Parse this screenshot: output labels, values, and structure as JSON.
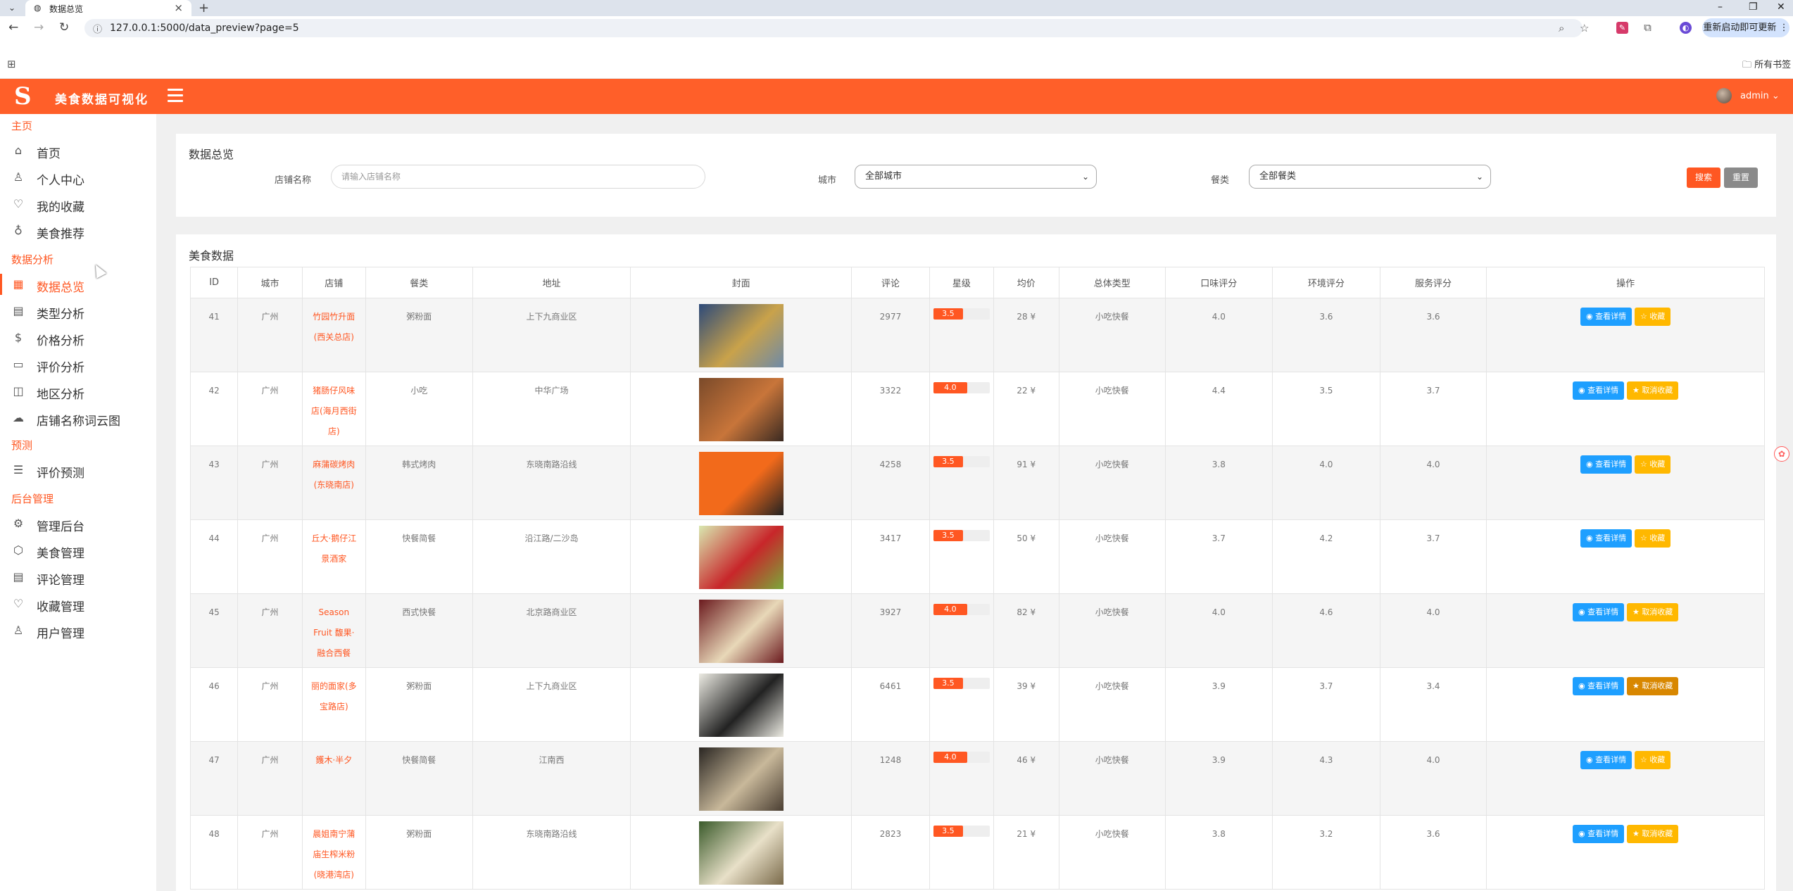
{
  "browser": {
    "tab_title": "数据总览",
    "url": "127.0.0.1:5000/data_preview?page=5",
    "restart_label": "重新启动即可更新",
    "bookmarks_label": "所有书签"
  },
  "header": {
    "app_title": "美食数据可视化",
    "user": "admin"
  },
  "sidebar": {
    "sections": [
      {
        "title": "主页",
        "items": [
          {
            "label": "首页",
            "icon": "home-icon"
          },
          {
            "label": "个人中心",
            "icon": "user-icon"
          },
          {
            "label": "我的收藏",
            "icon": "heart-icon"
          },
          {
            "label": "美食推荐",
            "icon": "lightbulb-icon"
          }
        ]
      },
      {
        "title": "数据分析",
        "items": [
          {
            "label": "数据总览",
            "icon": "table-icon"
          },
          {
            "label": "类型分析",
            "icon": "bar-chart-icon"
          },
          {
            "label": "价格分析",
            "icon": "dollar-icon"
          },
          {
            "label": "评价分析",
            "icon": "comment-icon"
          },
          {
            "label": "地区分析",
            "icon": "map-icon"
          },
          {
            "label": "店铺名称词云图",
            "icon": "cloud-icon"
          }
        ]
      },
      {
        "title": "预测",
        "items": [
          {
            "label": "评价预测",
            "icon": "list-icon"
          }
        ]
      },
      {
        "title": "后台管理",
        "items": [
          {
            "label": "管理后台",
            "icon": "gear-icon"
          },
          {
            "label": "美食管理",
            "icon": "cube-icon"
          },
          {
            "label": "评论管理",
            "icon": "message-icon"
          },
          {
            "label": "收藏管理",
            "icon": "heart-outline-icon"
          },
          {
            "label": "用户管理",
            "icon": "user-icon"
          }
        ]
      }
    ]
  },
  "filter": {
    "title": "数据总览",
    "shop_label": "店铺名称",
    "shop_placeholder": "请输入店铺名称",
    "city_label": "城市",
    "city_value": "全部城市",
    "cuisine_label": "餐类",
    "cuisine_value": "全部餐类",
    "search_btn": "搜索",
    "reset_btn": "重置"
  },
  "table": {
    "title": "美食数据",
    "columns": [
      "ID",
      "城市",
      "店铺",
      "餐类",
      "地址",
      "封面",
      "评论",
      "星级",
      "均价",
      "总体类型",
      "口味评分",
      "环境评分",
      "服务评分",
      "操作"
    ],
    "view_label": "查看详情",
    "fav_label": "收藏",
    "unfav_label": "取消收藏",
    "rows": [
      {
        "id": "41",
        "city": "广州",
        "shop": "竹园竹升面(西关总店)",
        "cuisine": "粥粉面",
        "addr": "上下九商业区",
        "reviews": "2977",
        "star": "3.5",
        "star_frac": 0.7,
        "price": "28 ¥",
        "type": "小吃快餐",
        "taste": "4.0",
        "env": "3.6",
        "service": "3.6",
        "fav": false,
        "cover": [
          "#2d4a7a",
          "#c9a24a",
          "#6e8aa8"
        ]
      },
      {
        "id": "42",
        "city": "广州",
        "shop": "猪肠仔风味店(海月西街店)",
        "cuisine": "小吃",
        "addr": "中华广场",
        "reviews": "3322",
        "star": "4.0",
        "star_frac": 0.8,
        "price": "22 ¥",
        "type": "小吃快餐",
        "taste": "4.4",
        "env": "3.5",
        "service": "3.7",
        "fav": true,
        "cover": [
          "#7a4a2a",
          "#c8753a",
          "#3a2a22"
        ]
      },
      {
        "id": "43",
        "city": "广州",
        "shop": "麻蒲碳烤肉(东晓南店)",
        "cuisine": "韩式烤肉",
        "addr": "东晓南路沿线",
        "reviews": "4258",
        "star": "3.5",
        "star_frac": 0.7,
        "price": "91 ¥",
        "type": "小吃快餐",
        "taste": "3.8",
        "env": "4.0",
        "service": "4.0",
        "fav": false,
        "cover": [
          "#f26a1b",
          "#f26a1b",
          "#222222"
        ]
      },
      {
        "id": "44",
        "city": "广州",
        "shop": "丘大·鹅仔江景酒家",
        "cuisine": "快餐简餐",
        "addr": "沿江路/二沙岛",
        "reviews": "3417",
        "star": "3.5",
        "star_frac": 0.7,
        "price": "50 ¥",
        "type": "小吃快餐",
        "taste": "3.7",
        "env": "4.2",
        "service": "3.7",
        "fav": false,
        "cover": [
          "#d9e8b0",
          "#c8262a",
          "#7aa83a"
        ]
      },
      {
        "id": "45",
        "city": "广州",
        "shop": "Season Fruit 馥果·融合西餐",
        "cuisine": "西式快餐",
        "addr": "北京路商业区",
        "reviews": "3927",
        "star": "4.0",
        "star_frac": 0.8,
        "price": "82 ¥",
        "type": "小吃快餐",
        "taste": "4.0",
        "env": "4.6",
        "service": "4.0",
        "fav": true,
        "cover": [
          "#6b1a1e",
          "#e8d8b8",
          "#6b1a1e"
        ]
      },
      {
        "id": "46",
        "city": "广州",
        "shop": "丽的面家(多宝路店)",
        "cuisine": "粥粉面",
        "addr": "上下九商业区",
        "reviews": "6461",
        "star": "3.5",
        "star_frac": 0.7,
        "price": "39 ¥",
        "type": "小吃快餐",
        "taste": "3.9",
        "env": "3.7",
        "service": "3.4",
        "fav": true,
        "cover": [
          "#ecebe3",
          "#222222",
          "#ecebe3"
        ]
      },
      {
        "id": "47",
        "city": "广州",
        "shop": "鑊木·半夕",
        "cuisine": "快餐简餐",
        "addr": "江南西",
        "reviews": "1248",
        "star": "4.0",
        "star_frac": 0.8,
        "price": "46 ¥",
        "type": "小吃快餐",
        "taste": "3.9",
        "env": "4.3",
        "service": "4.0",
        "fav": false,
        "cover": [
          "#2a2622",
          "#c8b89a",
          "#4a3e32"
        ]
      },
      {
        "id": "48",
        "city": "广州",
        "shop": "晨姐南宁蒲庙生榨米粉(晓港湾店)",
        "cuisine": "粥粉面",
        "addr": "东晓南路沿线",
        "reviews": "2823",
        "star": "3.5",
        "star_frac": 0.7,
        "price": "21 ¥",
        "type": "小吃快餐",
        "taste": "3.8",
        "env": "3.2",
        "service": "3.6",
        "fav": true,
        "cover": [
          "#3a5a2a",
          "#e8e0c8",
          "#7a6a4a"
        ]
      }
    ]
  }
}
